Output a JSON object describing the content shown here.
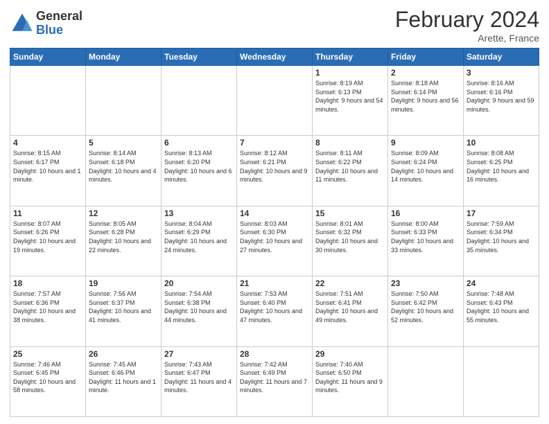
{
  "header": {
    "logo_general": "General",
    "logo_blue": "Blue",
    "main_title": "February 2024",
    "subtitle": "Arette, France"
  },
  "days_of_week": [
    "Sunday",
    "Monday",
    "Tuesday",
    "Wednesday",
    "Thursday",
    "Friday",
    "Saturday"
  ],
  "weeks": [
    [
      {
        "day": "",
        "info": ""
      },
      {
        "day": "",
        "info": ""
      },
      {
        "day": "",
        "info": ""
      },
      {
        "day": "",
        "info": ""
      },
      {
        "day": "1",
        "info": "Sunrise: 8:19 AM\nSunset: 6:13 PM\nDaylight: 9 hours and 54 minutes."
      },
      {
        "day": "2",
        "info": "Sunrise: 8:18 AM\nSunset: 6:14 PM\nDaylight: 9 hours and 56 minutes."
      },
      {
        "day": "3",
        "info": "Sunrise: 8:16 AM\nSunset: 6:16 PM\nDaylight: 9 hours and 59 minutes."
      }
    ],
    [
      {
        "day": "4",
        "info": "Sunrise: 8:15 AM\nSunset: 6:17 PM\nDaylight: 10 hours and 1 minute."
      },
      {
        "day": "5",
        "info": "Sunrise: 8:14 AM\nSunset: 6:18 PM\nDaylight: 10 hours and 4 minutes."
      },
      {
        "day": "6",
        "info": "Sunrise: 8:13 AM\nSunset: 6:20 PM\nDaylight: 10 hours and 6 minutes."
      },
      {
        "day": "7",
        "info": "Sunrise: 8:12 AM\nSunset: 6:21 PM\nDaylight: 10 hours and 9 minutes."
      },
      {
        "day": "8",
        "info": "Sunrise: 8:11 AM\nSunset: 6:22 PM\nDaylight: 10 hours and 11 minutes."
      },
      {
        "day": "9",
        "info": "Sunrise: 8:09 AM\nSunset: 6:24 PM\nDaylight: 10 hours and 14 minutes."
      },
      {
        "day": "10",
        "info": "Sunrise: 8:08 AM\nSunset: 6:25 PM\nDaylight: 10 hours and 16 minutes."
      }
    ],
    [
      {
        "day": "11",
        "info": "Sunrise: 8:07 AM\nSunset: 6:26 PM\nDaylight: 10 hours and 19 minutes."
      },
      {
        "day": "12",
        "info": "Sunrise: 8:05 AM\nSunset: 6:28 PM\nDaylight: 10 hours and 22 minutes."
      },
      {
        "day": "13",
        "info": "Sunrise: 8:04 AM\nSunset: 6:29 PM\nDaylight: 10 hours and 24 minutes."
      },
      {
        "day": "14",
        "info": "Sunrise: 8:03 AM\nSunset: 6:30 PM\nDaylight: 10 hours and 27 minutes."
      },
      {
        "day": "15",
        "info": "Sunrise: 8:01 AM\nSunset: 6:32 PM\nDaylight: 10 hours and 30 minutes."
      },
      {
        "day": "16",
        "info": "Sunrise: 8:00 AM\nSunset: 6:33 PM\nDaylight: 10 hours and 33 minutes."
      },
      {
        "day": "17",
        "info": "Sunrise: 7:59 AM\nSunset: 6:34 PM\nDaylight: 10 hours and 35 minutes."
      }
    ],
    [
      {
        "day": "18",
        "info": "Sunrise: 7:57 AM\nSunset: 6:36 PM\nDaylight: 10 hours and 38 minutes."
      },
      {
        "day": "19",
        "info": "Sunrise: 7:56 AM\nSunset: 6:37 PM\nDaylight: 10 hours and 41 minutes."
      },
      {
        "day": "20",
        "info": "Sunrise: 7:54 AM\nSunset: 6:38 PM\nDaylight: 10 hours and 44 minutes."
      },
      {
        "day": "21",
        "info": "Sunrise: 7:53 AM\nSunset: 6:40 PM\nDaylight: 10 hours and 47 minutes."
      },
      {
        "day": "22",
        "info": "Sunrise: 7:51 AM\nSunset: 6:41 PM\nDaylight: 10 hours and 49 minutes."
      },
      {
        "day": "23",
        "info": "Sunrise: 7:50 AM\nSunset: 6:42 PM\nDaylight: 10 hours and 52 minutes."
      },
      {
        "day": "24",
        "info": "Sunrise: 7:48 AM\nSunset: 6:43 PM\nDaylight: 10 hours and 55 minutes."
      }
    ],
    [
      {
        "day": "25",
        "info": "Sunrise: 7:46 AM\nSunset: 6:45 PM\nDaylight: 10 hours and 58 minutes."
      },
      {
        "day": "26",
        "info": "Sunrise: 7:45 AM\nSunset: 6:46 PM\nDaylight: 11 hours and 1 minute."
      },
      {
        "day": "27",
        "info": "Sunrise: 7:43 AM\nSunset: 6:47 PM\nDaylight: 11 hours and 4 minutes."
      },
      {
        "day": "28",
        "info": "Sunrise: 7:42 AM\nSunset: 6:49 PM\nDaylight: 11 hours and 7 minutes."
      },
      {
        "day": "29",
        "info": "Sunrise: 7:40 AM\nSunset: 6:50 PM\nDaylight: 11 hours and 9 minutes."
      },
      {
        "day": "",
        "info": ""
      },
      {
        "day": "",
        "info": ""
      }
    ]
  ]
}
